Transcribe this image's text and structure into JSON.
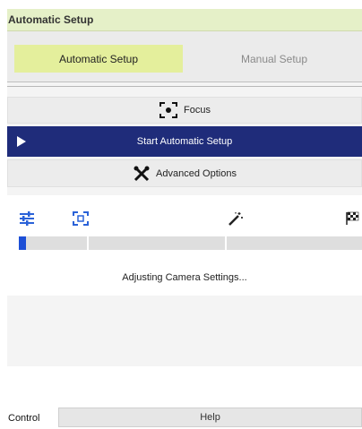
{
  "panel": {
    "title": "Automatic Setup"
  },
  "tabs": [
    {
      "label": "Automatic Setup",
      "active": true
    },
    {
      "label": "Manual Setup",
      "active": false
    }
  ],
  "buttons": {
    "focus": "Focus",
    "start": "Start Automatic Setup",
    "advanced": "Advanced Options"
  },
  "progress": {
    "steps": [
      {
        "icon": "sliders-icon"
      },
      {
        "icon": "focus-frame-icon"
      },
      {
        "icon": "magic-wand-icon"
      },
      {
        "icon": "checkered-flag-icon"
      }
    ],
    "fraction": 0.02,
    "status": "Adjusting Camera Settings..."
  },
  "footer": {
    "control_label": "Control",
    "help_label": "Help"
  },
  "colors": {
    "title_bg": "#e5f0c8",
    "active_tab_bg": "#e4ef9c",
    "start_button_bg": "#1f2c7a",
    "accent_blue": "#1d4fd6"
  }
}
